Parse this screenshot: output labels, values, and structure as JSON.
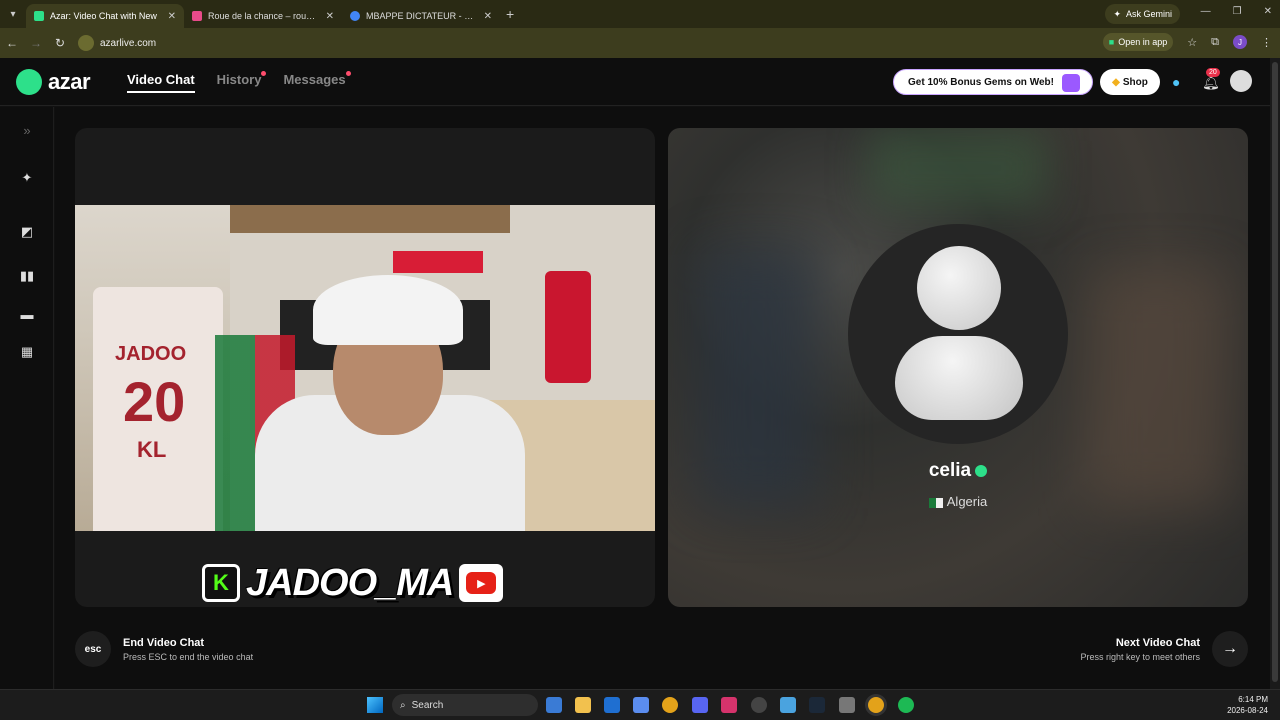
{
  "browser": {
    "tabs": [
      {
        "title": "Azar: Video Chat with New",
        "active": true,
        "color": "#2de08a"
      },
      {
        "title": "Roue de la chance – roue aléat",
        "active": false,
        "color": "#e84b8a"
      },
      {
        "title": "MBAPPE DICTATEUR - Recherch",
        "active": false,
        "color": "#4285f4"
      }
    ],
    "new_tab": "+",
    "ask_gemini": "Ask Gemini",
    "url": "azarlive.com",
    "open_in_app": "Open in app",
    "profile_initial": "J"
  },
  "app": {
    "logo_text": "azar",
    "nav": [
      {
        "label": "Video Chat",
        "active": true,
        "dot": false
      },
      {
        "label": "History",
        "active": false,
        "dot": true
      },
      {
        "label": "Messages",
        "active": false,
        "dot": true
      }
    ],
    "promo_label": "Get 10% Bonus Gems on Web!",
    "shop_label": "Shop",
    "notification_count": "20"
  },
  "rail_icons": [
    "expand-icon",
    "magic-wand-icon",
    "filter-icon",
    "layout-side-icon",
    "layout-stack-icon",
    "layout-grid-icon"
  ],
  "self_video": {
    "overlay_handle": "JADOO_MA",
    "jersey_name": "JADOO",
    "jersey_number": "20",
    "jersey_initials": "KL"
  },
  "peer": {
    "name": "celia",
    "country": "Algeria"
  },
  "footer": {
    "esc_key": "esc",
    "end_title": "End Video Chat",
    "end_subtitle": "Press ESC to end the video chat",
    "next_title": "Next Video Chat",
    "next_subtitle": "Press right key to meet others",
    "next_arrow": "→"
  },
  "taskbar": {
    "search_label": "Search",
    "time": "6:14 PM",
    "date": "2026-08-24"
  }
}
